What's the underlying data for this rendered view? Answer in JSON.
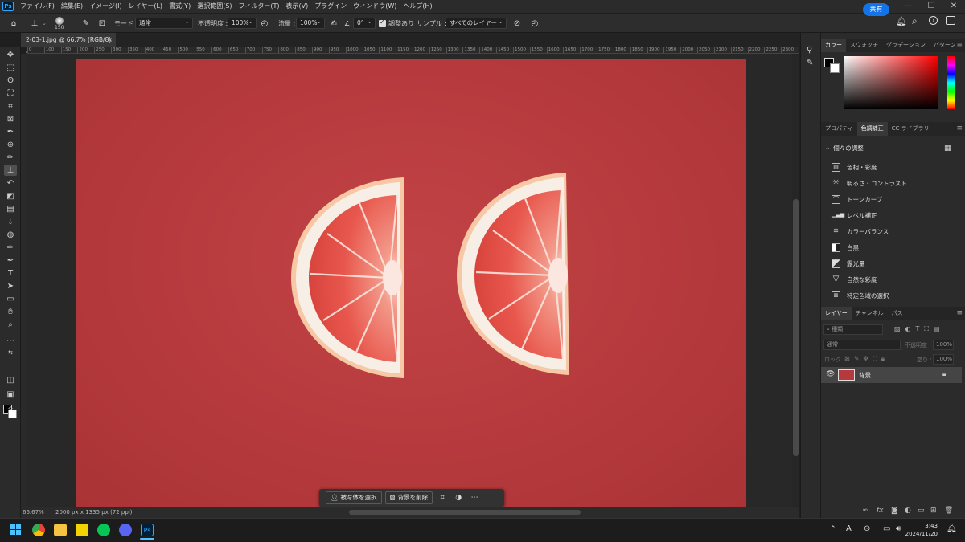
{
  "menubar": {
    "logo": "Ps",
    "items": [
      "ファイル(F)",
      "編集(E)",
      "イメージ(I)",
      "レイヤー(L)",
      "書式(Y)",
      "選択範囲(S)",
      "フィルター(T)",
      "表示(V)",
      "プラグイン",
      "ウィンドウ(W)",
      "ヘルプ(H)"
    ],
    "window_controls": [
      "—",
      "☐",
      "✕"
    ]
  },
  "options": {
    "brush_size": "150",
    "mode_label": "モード :",
    "mode_value": "通常",
    "opacity_label": "不透明度 :",
    "opacity_value": "100%",
    "flow_label": "流量 :",
    "flow_value": "100%",
    "angle_value": "0°",
    "aligned_label": "調整あり",
    "sample_label": "サンプル :",
    "sample_value": "すべてのレイヤー",
    "share_label": "共有"
  },
  "document": {
    "tab_title": "2-03-1.jpg @ 66.7% (RGB/8) *",
    "tab_close": "×",
    "zoom": "66.67%",
    "size_info": "2000 px x 1335 px (72 ppi)"
  },
  "ruler": {
    "ticks": [
      "0",
      "100",
      "150",
      "200",
      "250",
      "300",
      "350",
      "400",
      "450",
      "500",
      "550",
      "600",
      "650",
      "700",
      "750",
      "800",
      "850",
      "900",
      "950",
      "1000",
      "1050",
      "1100",
      "1150",
      "1200",
      "1250",
      "1300",
      "1350",
      "1400",
      "1450",
      "1500",
      "1550",
      "1600",
      "1650",
      "1700",
      "1750",
      "1800",
      "1850",
      "1900",
      "1950",
      "2000",
      "2050",
      "2100",
      "2150",
      "2200",
      "2250",
      "2300"
    ]
  },
  "context_bar": {
    "select_subject": "被写体を選択",
    "remove_background": "背景を削除",
    "more": "⋯"
  },
  "color_panel": {
    "tabs": [
      "カラー",
      "スウォッチ",
      "グラデーション",
      "パターン"
    ],
    "active_tab": 0
  },
  "adjust_panel": {
    "tabs": [
      "プロパティ",
      "色調補正",
      "CC ライブラリ"
    ],
    "active_tab": 1,
    "section_title": "個々の調整",
    "items": [
      "色相・彩度",
      "明るさ・コントラスト",
      "トーンカーブ",
      "レベル補正",
      "カラーバランス",
      "白黒",
      "露光量",
      "自然な彩度",
      "特定色域の選択"
    ]
  },
  "layers_panel": {
    "tabs": [
      "レイヤー",
      "チャンネル",
      "パス"
    ],
    "active_tab": 0,
    "filter_placeholder": "種類",
    "blend_mode": "通常",
    "opacity_label": "不透明度 :",
    "opacity_value": "100%",
    "lock_label": "ロック :",
    "fill_label": "塗り :",
    "fill_value": "100%",
    "layers": [
      {
        "name": "背景",
        "visible": true,
        "locked": true
      }
    ]
  },
  "taskbar": {
    "time": "3:43",
    "date": "2024/11/20",
    "ime": "A",
    "ps_label": "Ps"
  },
  "colors": {
    "photo_red": "#b63a3d",
    "accent_blue": "#1473e6"
  }
}
